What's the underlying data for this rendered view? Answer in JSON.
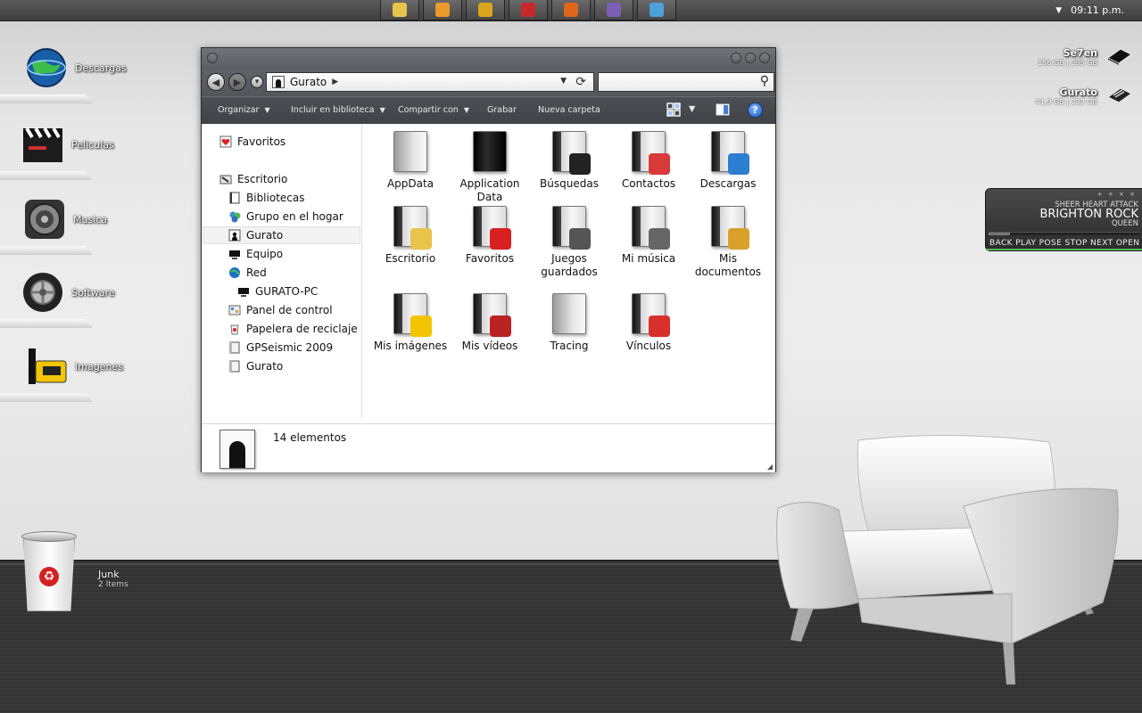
{
  "taskbar": {
    "apps": [
      {
        "icon": "notes-icon",
        "color": "#e8c44a"
      },
      {
        "icon": "media-player-icon",
        "color": "#e99a2a"
      },
      {
        "icon": "winamp-icon",
        "color": "#d9a51c"
      },
      {
        "icon": "flash-icon",
        "color": "#c8282a"
      },
      {
        "icon": "firefox-icon",
        "color": "#e0661c"
      },
      {
        "icon": "pidgin-icon",
        "color": "#7a5fb5"
      },
      {
        "icon": "photo-viewer-icon",
        "color": "#4aa2d8"
      }
    ],
    "clock": "09:11 p.m."
  },
  "shelves": [
    {
      "label": "Descargas",
      "icon": "globe-download-icon"
    },
    {
      "label": "Peliculas",
      "icon": "clapperboard-icon"
    },
    {
      "label": "Musica",
      "icon": "speaker-icon"
    },
    {
      "label": "Software",
      "icon": "tire-icon"
    },
    {
      "label": "Imagenes",
      "icon": "film-roll-icon"
    }
  ],
  "window": {
    "address_segment": "Gurato",
    "search_placeholder": "",
    "commands": {
      "organize": "Organizar",
      "include": "Incluir en biblioteca",
      "share": "Compartir con",
      "burn": "Grabar",
      "new_folder": "Nueva carpeta"
    },
    "help_label": "?",
    "nav": {
      "favorites": "Favoritos",
      "desktop": "Escritorio",
      "libraries": "Bibliotecas",
      "homegroup": "Grupo en el hogar",
      "user": "Gurato",
      "computer": "Equipo",
      "network": "Red",
      "pc": "GURATO-PC",
      "control_panel": "Panel de control",
      "recycle_bin": "Papelera de reciclaje",
      "gpseismic": "GPSeismic 2009",
      "user2": "Gurato"
    },
    "items": [
      {
        "label": "AppData",
        "icon": "folder-icon",
        "style": "gray"
      },
      {
        "label": "Application Data",
        "icon": "folder-shortcut-icon",
        "style": "black"
      },
      {
        "label": "Búsquedas",
        "icon": "search-folder-icon",
        "style": "white"
      },
      {
        "label": "Contactos",
        "icon": "contacts-folder-icon",
        "style": "white"
      },
      {
        "label": "Descargas",
        "icon": "downloads-folder-icon",
        "style": "white"
      },
      {
        "label": "Escritorio",
        "icon": "desktop-folder-icon",
        "style": "white"
      },
      {
        "label": "Favoritos",
        "icon": "favorites-folder-icon",
        "style": "white"
      },
      {
        "label": "Juegos guardados",
        "icon": "saved-games-folder-icon",
        "style": "white"
      },
      {
        "label": "Mi música",
        "icon": "music-folder-icon",
        "style": "white"
      },
      {
        "label": "Mis documentos",
        "icon": "documents-folder-icon",
        "style": "white"
      },
      {
        "label": "Mis imágenes",
        "icon": "pictures-folder-icon",
        "style": "white"
      },
      {
        "label": "Mis vídeos",
        "icon": "videos-folder-icon",
        "style": "white"
      },
      {
        "label": "Tracing",
        "icon": "folder-icon",
        "style": "gray"
      },
      {
        "label": "Vínculos",
        "icon": "links-folder-icon",
        "style": "white"
      }
    ],
    "status": "14 elementos"
  },
  "drives": [
    {
      "name": "Se7en",
      "size": "156 GB | 285 GB"
    },
    {
      "name": "Gurato",
      "size": "41,9 GB | 232 GB"
    }
  ],
  "player": {
    "album": "SHEER HEART ATTACK",
    "track": "BRIGHTON ROCK",
    "artist": "QUEEN",
    "controls_top": "+ + × ×",
    "buttons": "BACK PLAY POSE STOP NEXT OPEN",
    "progress": 0.14
  },
  "trash": {
    "label": "Junk",
    "count": "2 Items"
  }
}
